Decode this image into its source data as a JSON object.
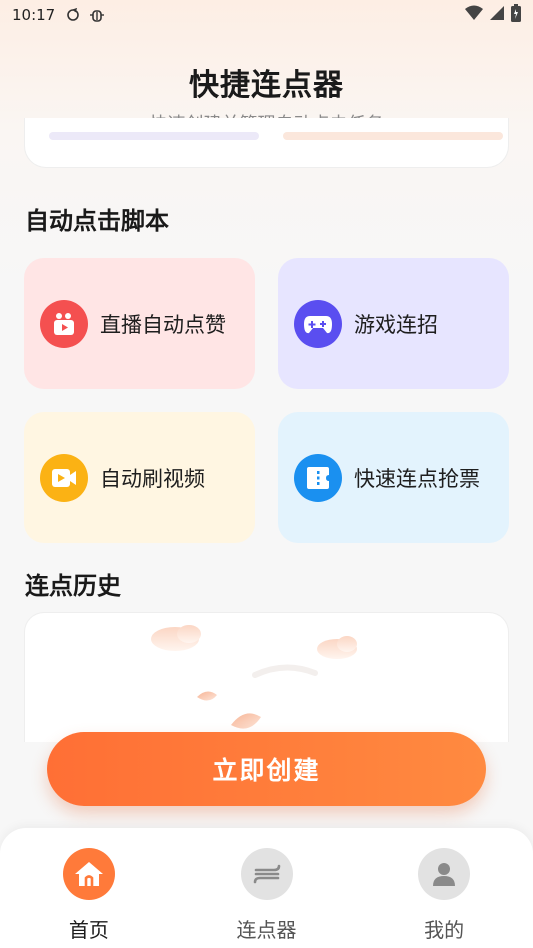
{
  "status_bar": {
    "time": "10:17",
    "left_icons": [
      "sync-icon",
      "bug-icon"
    ],
    "right_icons": [
      "wifi-icon",
      "signal-icon",
      "battery-icon"
    ]
  },
  "header": {
    "title": "快捷连点器",
    "subtitle": "快速创建并管理自动点击任务"
  },
  "scripts_section": {
    "title": "自动点击脚本",
    "tiles": [
      {
        "label": "直播自动点赞",
        "icon": "live-video-icon",
        "bg": "#ffe5e5",
        "icon_bg": "#f45050"
      },
      {
        "label": "游戏连招",
        "icon": "gamepad-icon",
        "bg": "#e7e5ff",
        "icon_bg": "#5a4ef0"
      },
      {
        "label": "自动刷视频",
        "icon": "video-play-icon",
        "bg": "#fff6e2",
        "icon_bg": "#fbb214"
      },
      {
        "label": "快速连点抢票",
        "icon": "ticket-icon",
        "bg": "#e3f3fd",
        "icon_bg": "#1a90f0"
      }
    ]
  },
  "history_section": {
    "title": "连点历史"
  },
  "create_button": {
    "label": "立即创建"
  },
  "bottom_nav": {
    "items": [
      {
        "label": "首页",
        "icon": "home-icon",
        "active": true
      },
      {
        "label": "连点器",
        "icon": "clicker-icon",
        "active": false
      },
      {
        "label": "我的",
        "icon": "profile-icon",
        "active": false
      }
    ]
  },
  "colors": {
    "accent": "#ff7a3a",
    "nav_inactive_icon_bg": "#e2e2e2"
  }
}
